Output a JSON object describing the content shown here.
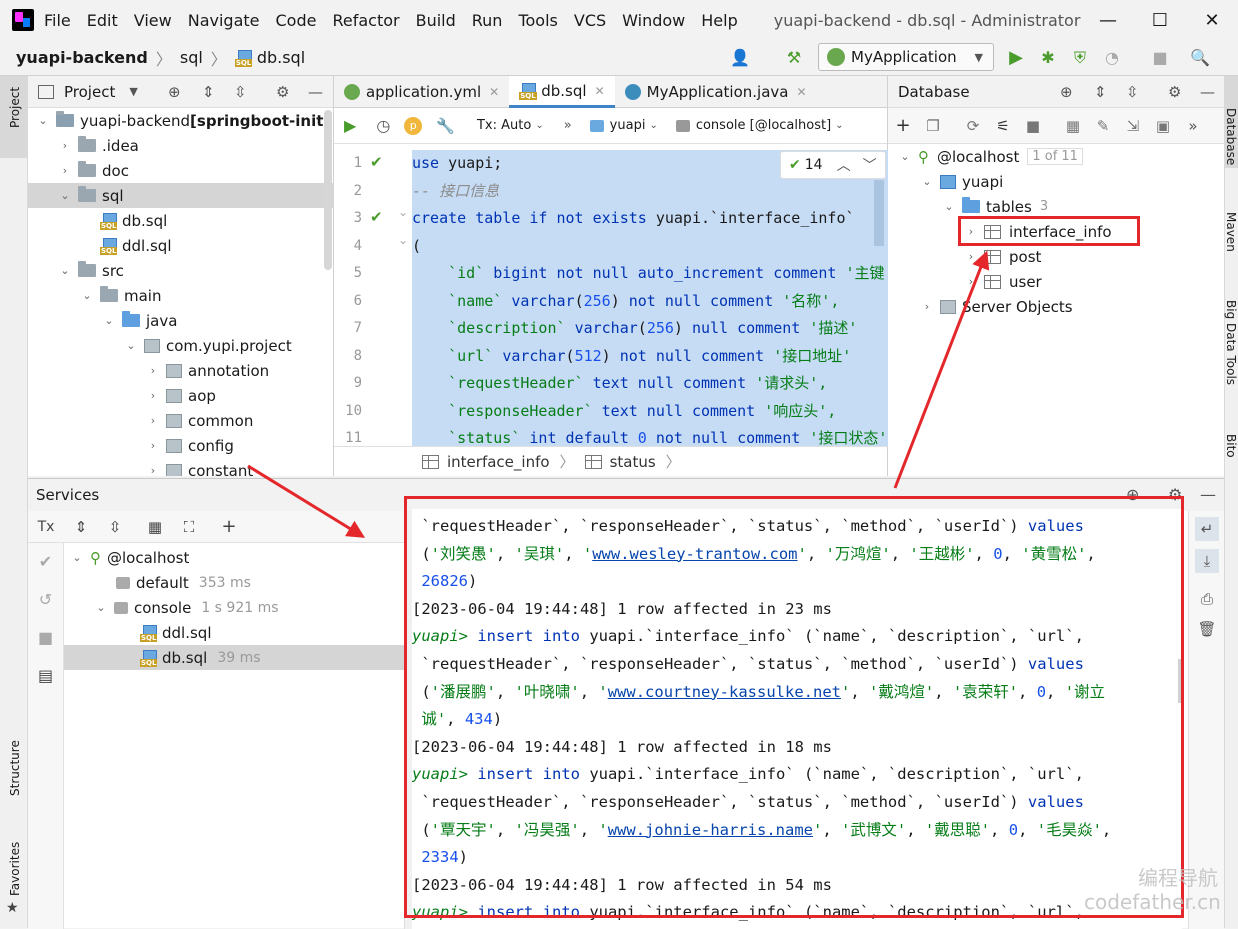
{
  "window": {
    "menu": [
      "File",
      "Edit",
      "View",
      "Navigate",
      "Code",
      "Refactor",
      "Build",
      "Run",
      "Tools",
      "VCS",
      "Window",
      "Help"
    ],
    "title": "yuapi-backend - db.sql - Administrator"
  },
  "breadcrumb": {
    "project": "yuapi-backend",
    "folder": "sql",
    "file": "db.sql"
  },
  "run_config": "MyApplication",
  "project_panel": {
    "title": "Project",
    "root_name": "yuapi-backend",
    "root_module": "[springboot-init]",
    "items": [
      ".idea",
      "doc",
      "sql",
      "db.sql",
      "ddl.sql",
      "src",
      "main",
      "java",
      "com.yupi.project",
      "annotation",
      "aop",
      "common",
      "config",
      "constant"
    ]
  },
  "editor": {
    "tabs": [
      "application.yml",
      "db.sql",
      "MyApplication.java"
    ],
    "tx": "Tx: Auto",
    "schema": "yuapi",
    "session": "console [@localhost]",
    "check_count": "14",
    "line_numbers": [
      "1",
      "2",
      "3",
      "4",
      "5",
      "6",
      "7",
      "8",
      "9",
      "10",
      "11"
    ],
    "lines": [
      [
        {
          "t": "use ",
          "c": "kw"
        },
        {
          "t": "yuapi;",
          "c": ""
        }
      ],
      [
        {
          "t": "-- 接口信息",
          "c": "cm"
        }
      ],
      [
        {
          "t": "create table if not exists ",
          "c": "kw"
        },
        {
          "t": "yuapi.`interface_info`",
          "c": ""
        }
      ],
      [
        {
          "t": "(",
          "c": ""
        }
      ],
      [
        {
          "t": "    `id` ",
          "c": "str"
        },
        {
          "t": "bigint not null auto_increment comment ",
          "c": "kw"
        },
        {
          "t": "'主键'",
          "c": "str"
        }
      ],
      [
        {
          "t": "    `name` ",
          "c": "str"
        },
        {
          "t": "varchar",
          "c": "kw"
        },
        {
          "t": "(",
          "c": ""
        },
        {
          "t": "256",
          "c": "num"
        },
        {
          "t": ") ",
          "c": ""
        },
        {
          "t": "not null comment ",
          "c": "kw"
        },
        {
          "t": "'名称',",
          "c": "str"
        }
      ],
      [
        {
          "t": "    `description` ",
          "c": "str"
        },
        {
          "t": "varchar",
          "c": "kw"
        },
        {
          "t": "(",
          "c": ""
        },
        {
          "t": "256",
          "c": "num"
        },
        {
          "t": ") ",
          "c": ""
        },
        {
          "t": "null comment ",
          "c": "kw"
        },
        {
          "t": "'描述'",
          "c": "str"
        }
      ],
      [
        {
          "t": "    `url` ",
          "c": "str"
        },
        {
          "t": "varchar",
          "c": "kw"
        },
        {
          "t": "(",
          "c": ""
        },
        {
          "t": "512",
          "c": "num"
        },
        {
          "t": ") ",
          "c": ""
        },
        {
          "t": "not null comment ",
          "c": "kw"
        },
        {
          "t": "'接口地址'",
          "c": "str"
        }
      ],
      [
        {
          "t": "    `requestHeader` ",
          "c": "str"
        },
        {
          "t": "text null comment ",
          "c": "kw"
        },
        {
          "t": "'请求头',",
          "c": "str"
        }
      ],
      [
        {
          "t": "    `responseHeader` ",
          "c": "str"
        },
        {
          "t": "text null comment ",
          "c": "kw"
        },
        {
          "t": "'响应头',",
          "c": "str"
        }
      ],
      [
        {
          "t": "    `status` ",
          "c": "str"
        },
        {
          "t": "int default ",
          "c": "kw"
        },
        {
          "t": "0 ",
          "c": "num"
        },
        {
          "t": "not null comment ",
          "c": "kw"
        },
        {
          "t": "'接口状态'",
          "c": "str"
        }
      ]
    ],
    "breadcrumb": [
      "interface_info",
      "status"
    ]
  },
  "database_panel": {
    "title": "Database",
    "host": "@localhost",
    "host_count": "1 of 11",
    "schema": "yuapi",
    "tables_label": "tables",
    "tables_count": "3",
    "tables": [
      "interface_info",
      "post",
      "user"
    ],
    "server_objects": "Server Objects"
  },
  "services_panel": {
    "title": "Services",
    "tx": "Tx",
    "host": "@localhost",
    "default": "default",
    "default_time": "353 ms",
    "console": "console",
    "console_time": "1 s 921 ms",
    "files": [
      {
        "name": "ddl.sql",
        "time": ""
      },
      {
        "name": "db.sql",
        "time": "39 ms"
      }
    ]
  },
  "console": {
    "lines": [
      [
        {
          "t": " `requestHeader`, `responseHeader`, `status`, `method`, `userId`) ",
          "c": ""
        },
        {
          "t": "values",
          "c": "kw"
        }
      ],
      [
        {
          "t": " (",
          "c": ""
        },
        {
          "t": "'刘笑愚'",
          "c": "str"
        },
        {
          "t": ", ",
          "c": ""
        },
        {
          "t": "'吴琪'",
          "c": "str"
        },
        {
          "t": ", ",
          "c": ""
        },
        {
          "t": "'",
          "c": "str"
        },
        {
          "t": "www.wesley-trantow.com",
          "c": "url"
        },
        {
          "t": "'",
          "c": "str"
        },
        {
          "t": ", ",
          "c": ""
        },
        {
          "t": "'万鸿煊'",
          "c": "str"
        },
        {
          "t": ", ",
          "c": ""
        },
        {
          "t": "'王越彬'",
          "c": "str"
        },
        {
          "t": ", ",
          "c": ""
        },
        {
          "t": "0",
          "c": "num"
        },
        {
          "t": ", ",
          "c": ""
        },
        {
          "t": "'黄雪松'",
          "c": "str"
        },
        {
          "t": ",",
          "c": ""
        }
      ],
      [
        {
          "t": " 26826",
          "c": "num"
        },
        {
          "t": ")",
          "c": ""
        }
      ],
      [
        {
          "t": "[2023-06-04 19:44:48] 1 row affected in 23 ms",
          "c": ""
        }
      ],
      [
        {
          "t": "yuapi> ",
          "c": "prompt"
        },
        {
          "t": "insert into ",
          "c": "kw"
        },
        {
          "t": "yuapi.`interface_info` (`name`, `description`, `url`,",
          "c": ""
        }
      ],
      [
        {
          "t": " `requestHeader`, `responseHeader`, `status`, `method`, `userId`) ",
          "c": ""
        },
        {
          "t": "values",
          "c": "kw"
        }
      ],
      [
        {
          "t": " (",
          "c": ""
        },
        {
          "t": "'潘展鹏'",
          "c": "str"
        },
        {
          "t": ", ",
          "c": ""
        },
        {
          "t": "'叶晓啸'",
          "c": "str"
        },
        {
          "t": ", ",
          "c": ""
        },
        {
          "t": "'",
          "c": "str"
        },
        {
          "t": "www.courtney-kassulke.net",
          "c": "url"
        },
        {
          "t": "'",
          "c": "str"
        },
        {
          "t": ", ",
          "c": ""
        },
        {
          "t": "'戴鸿煊'",
          "c": "str"
        },
        {
          "t": ", ",
          "c": ""
        },
        {
          "t": "'袁荣轩'",
          "c": "str"
        },
        {
          "t": ", ",
          "c": ""
        },
        {
          "t": "0",
          "c": "num"
        },
        {
          "t": ", ",
          "c": ""
        },
        {
          "t": "'谢立",
          "c": "str"
        }
      ],
      [
        {
          "t": " 诚'",
          "c": "str"
        },
        {
          "t": ", ",
          "c": ""
        },
        {
          "t": "434",
          "c": "num"
        },
        {
          "t": ")",
          "c": ""
        }
      ],
      [
        {
          "t": "[2023-06-04 19:44:48] 1 row affected in 18 ms",
          "c": ""
        }
      ],
      [
        {
          "t": "yuapi> ",
          "c": "prompt"
        },
        {
          "t": "insert into ",
          "c": "kw"
        },
        {
          "t": "yuapi.`interface_info` (`name`, `description`, `url`,",
          "c": ""
        }
      ],
      [
        {
          "t": " `requestHeader`, `responseHeader`, `status`, `method`, `userId`) ",
          "c": ""
        },
        {
          "t": "values",
          "c": "kw"
        }
      ],
      [
        {
          "t": " (",
          "c": ""
        },
        {
          "t": "'覃天宇'",
          "c": "str"
        },
        {
          "t": ", ",
          "c": ""
        },
        {
          "t": "'冯昊强'",
          "c": "str"
        },
        {
          "t": ", ",
          "c": ""
        },
        {
          "t": "'",
          "c": "str"
        },
        {
          "t": "www.johnie-harris.name",
          "c": "url"
        },
        {
          "t": "'",
          "c": "str"
        },
        {
          "t": ", ",
          "c": ""
        },
        {
          "t": "'武博文'",
          "c": "str"
        },
        {
          "t": ", ",
          "c": ""
        },
        {
          "t": "'戴思聪'",
          "c": "str"
        },
        {
          "t": ", ",
          "c": ""
        },
        {
          "t": "0",
          "c": "num"
        },
        {
          "t": ", ",
          "c": ""
        },
        {
          "t": "'毛昊焱'",
          "c": "str"
        },
        {
          "t": ",",
          "c": ""
        }
      ],
      [
        {
          "t": " 2334",
          "c": "num"
        },
        {
          "t": ")",
          "c": ""
        }
      ],
      [
        {
          "t": "[2023-06-04 19:44:48] 1 row affected in 54 ms",
          "c": ""
        }
      ],
      [
        {
          "t": "yuapi> ",
          "c": "prompt"
        },
        {
          "t": "insert into ",
          "c": "kw"
        },
        {
          "t": "yuapi.`interface_info` (`name`, `description`, `url`,",
          "c": ""
        }
      ]
    ]
  },
  "left_strip": {
    "project": "Project",
    "structure": "Structure",
    "favorites": "Favorites"
  },
  "right_strip": {
    "database": "Database",
    "maven": "Maven",
    "big_data": "Big Data Tools",
    "bito": "Bito"
  },
  "watermark": {
    "line1": "编程导航",
    "line2": "codefather.cn"
  },
  "colors": {
    "highlight": "#e3272b",
    "selection": "#c6dcf5",
    "keyword": "#0033b3",
    "string": "#067d17"
  }
}
